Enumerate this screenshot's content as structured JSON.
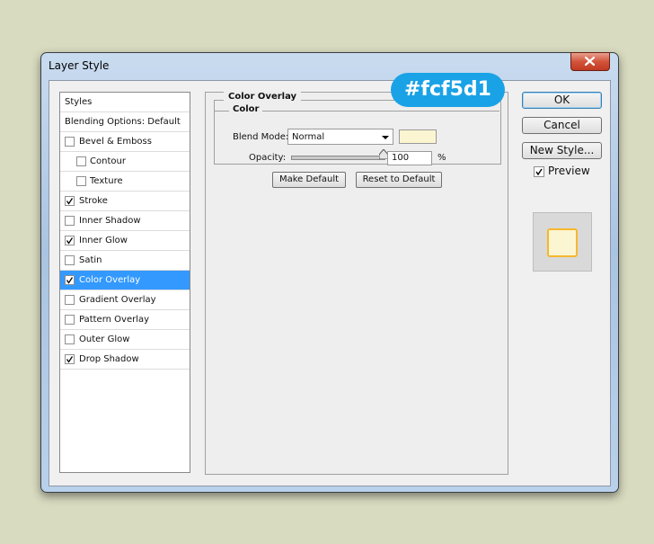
{
  "dialog": {
    "title": "Layer Style",
    "close_icon": "close-icon"
  },
  "styles_list": {
    "header": "Styles",
    "blending_options": "Blending Options: Default",
    "items": [
      {
        "label": "Bevel & Emboss",
        "checked": false,
        "sub": false
      },
      {
        "label": "Contour",
        "checked": false,
        "sub": true
      },
      {
        "label": "Texture",
        "checked": false,
        "sub": true
      },
      {
        "label": "Stroke",
        "checked": true,
        "sub": false
      },
      {
        "label": "Inner Shadow",
        "checked": false,
        "sub": false
      },
      {
        "label": "Inner Glow",
        "checked": true,
        "sub": false
      },
      {
        "label": "Satin",
        "checked": false,
        "sub": false
      },
      {
        "label": "Color Overlay",
        "checked": true,
        "sub": false,
        "selected": true
      },
      {
        "label": "Gradient Overlay",
        "checked": false,
        "sub": false
      },
      {
        "label": "Pattern Overlay",
        "checked": false,
        "sub": false
      },
      {
        "label": "Outer Glow",
        "checked": false,
        "sub": false
      },
      {
        "label": "Drop Shadow",
        "checked": true,
        "sub": false
      }
    ],
    "selected_color": "#3399ff"
  },
  "panel": {
    "section_title": "Color Overlay",
    "group_title": "Color",
    "blend_mode_label": "Blend Mode:",
    "blend_mode_value": "Normal",
    "swatch_color": "#fcf5d1",
    "opacity_label": "Opacity:",
    "opacity_value": "100",
    "opacity_fraction": 1.0,
    "opacity_unit": "%",
    "make_default": "Make Default",
    "reset_default": "Reset to Default"
  },
  "buttons": {
    "ok": "OK",
    "cancel": "Cancel",
    "new_style": "New Style..."
  },
  "preview": {
    "label": "Preview",
    "checked": true,
    "fill_color": "#fcf5d1",
    "stroke_color": "#f5b82e"
  },
  "annotation": {
    "text": "#fcf5d1",
    "color": "#1aa2e6"
  }
}
